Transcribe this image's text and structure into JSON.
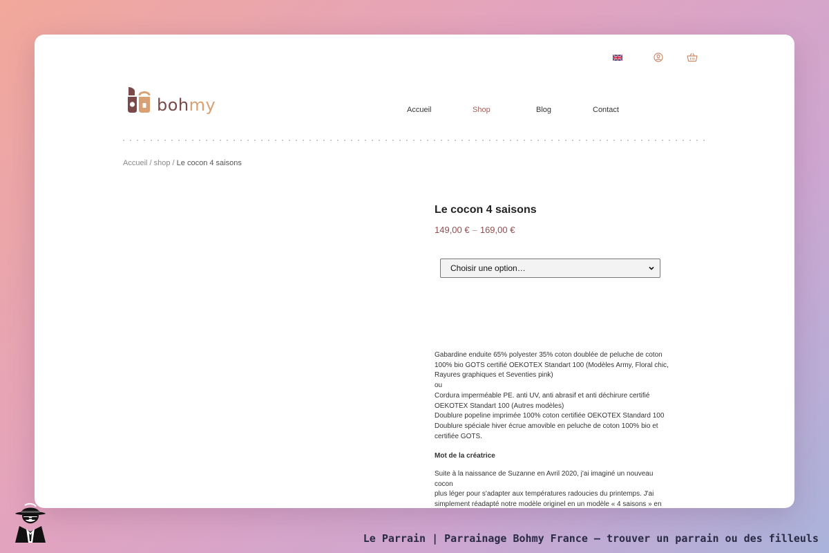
{
  "topbar": {
    "language_flag": "uk-flag-icon",
    "account_icon": "user-circle-icon",
    "cart_icon": "basket-icon"
  },
  "logo": {
    "text_part1": "boh",
    "text_part2": "my"
  },
  "nav": {
    "items": [
      {
        "label": "Accueil"
      },
      {
        "label": "Shop"
      },
      {
        "label": "Blog"
      },
      {
        "label": "Contact"
      }
    ],
    "active": "Shop"
  },
  "breadcrumb": {
    "home": "Accueil",
    "sep1": " / ",
    "shop": "shop",
    "sep2": " / ",
    "current": "Le cocon 4 saisons"
  },
  "product": {
    "title": "Le cocon 4 saisons",
    "price_min": "149,00 €",
    "price_dash": "–",
    "price_max": "169,00 €",
    "select_placeholder": "Choisir une option…",
    "description_lines": [
      "Gabardine enduite 65% polyester 35% coton doublée de peluche de coton",
      "100% bio GOTS certifié OEKOTEX Standart 100 (Modèles Army, Floral chic,",
      "Rayures graphiques et Seventies pink)",
      "ou",
      "Cordura imperméable PE. anti UV, anti abrasif et anti déchirure certifié",
      "OEKOTEX Standart 100 (Autres modèles)",
      "Doublure popeline imprimée 100% coton certifiée OEKOTEX Standard 100",
      "Doublure spéciale hiver écrue amovible en peluche de coton 100% bio et",
      "certifiée GOTS."
    ],
    "section_heading": "Mot de la créatrice",
    "story_lines": [
      "Suite à la naissance de Suzanne en Avril 2020, j'ai imaginé un nouveau cocon",
      "plus léger pour s'adapter aux températures radoucies du printemps. J'ai",
      "simplement réadapté notre modèle originel en un modèle « 4 saisons » en"
    ]
  },
  "footer": {
    "caption": "Le Parrain | Parrainage Bohmy France — trouver un parrain ou des filleuls",
    "mascot_icon": "godfather-mascot-icon"
  },
  "colors": {
    "brand_dark": "#7a4a4a",
    "brand_light": "#d9a073",
    "price": "#8f4f50",
    "nav_active": "#a0625f"
  }
}
